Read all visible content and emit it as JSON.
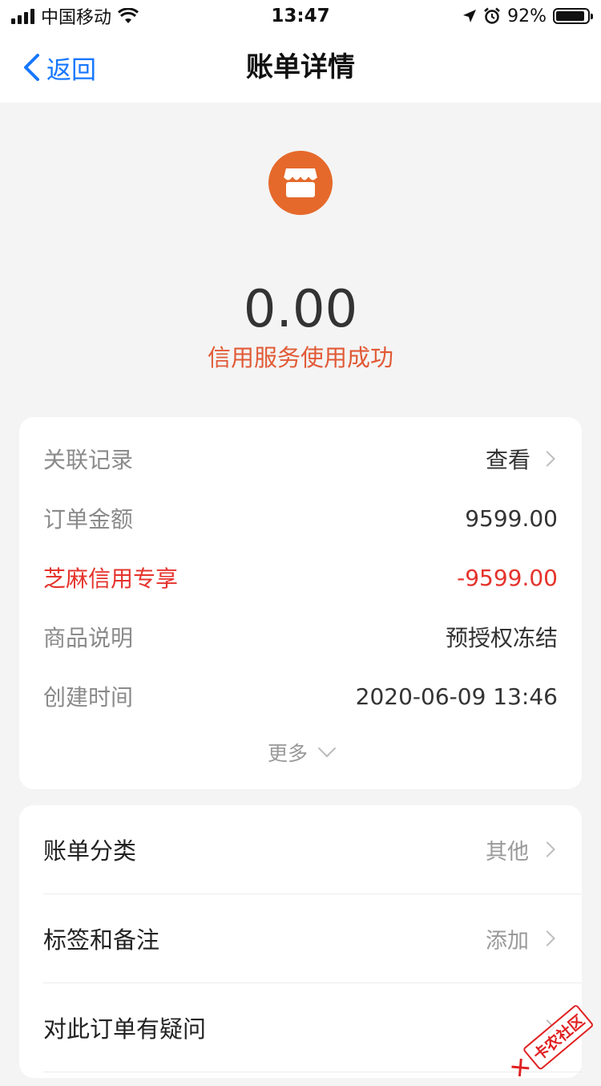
{
  "status_bar": {
    "carrier": "中国移动",
    "time": "13:47",
    "battery": "92%",
    "battery_level": 0.92
  },
  "nav": {
    "back_label": "返回",
    "title": "账单详情"
  },
  "header": {
    "icon": "store-icon",
    "icon_color": "#e5692b",
    "amount": "0.00",
    "status": "信用服务使用成功",
    "status_color": "#e15a36"
  },
  "details": {
    "rows": [
      {
        "label": "关联记录",
        "value": "查看"
      },
      {
        "label": "订单金额",
        "value": "9599.00"
      },
      {
        "label": "芝麻信用专享",
        "value": "-9599.00"
      },
      {
        "label": "商品说明",
        "value": "预授权冻结"
      },
      {
        "label": "创建时间",
        "value": "2020-06-09 13:46"
      }
    ],
    "more_label": "更多",
    "highlight_color": "#e5332c"
  },
  "actions": {
    "rows": [
      {
        "label": "账单分类",
        "value": "其他"
      },
      {
        "label": "标签和备注",
        "value": "添加"
      },
      {
        "label": "对此订单有疑问",
        "value": ""
      }
    ]
  },
  "watermark": {
    "text": "卡农社区"
  }
}
